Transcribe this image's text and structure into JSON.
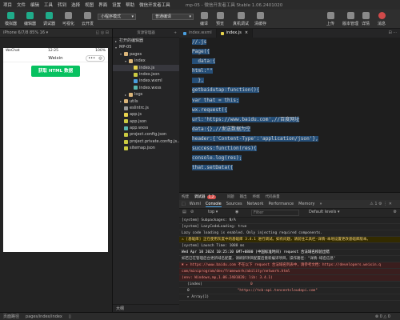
{
  "menubar": {
    "items": [
      "项目",
      "文件",
      "编辑",
      "工具",
      "转到",
      "选择",
      "视图",
      "界面",
      "设置",
      "帮助",
      "微信开发者工具"
    ],
    "title": "mp-05 - 微信开发者工具 Stable 1.06.2401020"
  },
  "toolbar": {
    "left_buttons": [
      "模拟器",
      "编辑器",
      "调试器",
      "可视化",
      "云开发"
    ],
    "mode_select": "小程序模式",
    "compile_select": "普通编译",
    "mid_buttons": [
      "编译",
      "预览",
      "真机调试",
      "清缓存"
    ],
    "right_buttons": [
      "上传",
      "版本管理",
      "详情",
      "消息"
    ]
  },
  "simulator": {
    "device_label": "iPhone 6/7/8 85% 16 ▾",
    "tools": "◱ ◎ ⊟",
    "status_left": "WeChat",
    "status_time": "12:25",
    "status_right": "100%",
    "nav_title": "Weixin",
    "capsule_dots": "•••",
    "capsule_circle": "◎",
    "button_label": "获取 HTML 数据"
  },
  "explorer": {
    "header": "资源管理器",
    "plus": "+",
    "items": [
      {
        "label": "打开的编辑器",
        "indent": 0,
        "type": "arrow",
        "arrow": "▸"
      },
      {
        "label": "MP-05",
        "indent": 0,
        "type": "arrow",
        "arrow": "▾"
      },
      {
        "label": "pages",
        "indent": 1,
        "type": "folder",
        "arrow": "▾"
      },
      {
        "label": "index",
        "indent": 2,
        "type": "folder",
        "arrow": "▾"
      },
      {
        "label": "index.js",
        "indent": 3,
        "type": "js",
        "selected": true
      },
      {
        "label": "index.json",
        "indent": 3,
        "type": "json"
      },
      {
        "label": "index.wxml",
        "indent": 3,
        "type": "wxml"
      },
      {
        "label": "index.wxss",
        "indent": 3,
        "type": "wxss"
      },
      {
        "label": "logs",
        "indent": 2,
        "type": "folder",
        "arrow": "▸"
      },
      {
        "label": "utils",
        "indent": 1,
        "type": "folder",
        "arrow": "▸"
      },
      {
        "label": "eslintrc.js",
        "indent": 1,
        "type": "file"
      },
      {
        "label": "app.js",
        "indent": 1,
        "type": "js"
      },
      {
        "label": "app.json",
        "indent": 1,
        "type": "json"
      },
      {
        "label": "app.wxss",
        "indent": 1,
        "type": "wxss"
      },
      {
        "label": "project.config.json",
        "indent": 1,
        "type": "json"
      },
      {
        "label": "project.private.config.js...",
        "indent": 1,
        "type": "json"
      },
      {
        "label": "sitemap.json",
        "indent": 1,
        "type": "json"
      }
    ],
    "outline": "大纲"
  },
  "editor": {
    "tabs": [
      {
        "label": "index.wxml",
        "active": false
      },
      {
        "label": "index.js",
        "active": true
      }
    ],
    "tools": "⊟ ···",
    "lines": [
      "//.js",
      "Page({",
      "  data:{",
      "html:\"\"",
      "  },",
      "getbaidutap:function(){",
      "var that = this;",
      "wx.request({",
      "url:'https://www.baidu.com',//百度网址",
      "data:{},//发送数据为空",
      "header:{'Content-Type':'application/json'},",
      "success:function(res){",
      "console.log(res);",
      "that.setData({"
    ]
  },
  "devtools": {
    "top_tabs": [
      "构建",
      "调试器",
      "问题",
      "输出",
      "终端",
      "代码质量"
    ],
    "badge": "1,2",
    "tabs": [
      "Wxml",
      "Console",
      "Sources",
      "Network",
      "Performance",
      "Memory"
    ],
    "more": "»",
    "right_icons": "⚠ 1  ⚙  ⋮  ✕",
    "context": "top",
    "filter_placeholder": "Filter",
    "levels": "Default levels ▾",
    "console_lines": [
      {
        "text": "[system] Subpackages: N/A",
        "kind": "normal",
        "src": ""
      },
      {
        "text": "[system] LazyCodeLoading: true",
        "kind": "normal",
        "src": ""
      },
      {
        "text": "Lazy code loading is enabled. Only injecting required components.",
        "kind": "normal",
        "src": ""
      },
      {
        "text": "⚠ [基础库] 正在使用灰度中的基础库 3.4.1 进行调试。如有问题，请前往工具栏-详情-本地设置更改基础库版本。",
        "kind": "warn",
        "src": ""
      },
      {
        "text": "[system] Launch Time: 1088 ms",
        "kind": "normal",
        "src": ""
      },
      {
        "text": "Wed Apr 10 2024 10:25:10 GMT+0800 (中国标准时间) request 合法域名校验出错",
        "kind": "bold",
        "src": ""
      },
      {
        "text": "如若已在管理后台更新域名配置，请刷新项目配置后重新编译项目，操作路径：\"详情-域名信息\"",
        "kind": "normal",
        "src": ""
      },
      {
        "text": "✖ ▸ https://www.baidu.com 不在以下 request 合法域名列表中，请参考文档：https://developers.weixin.q",
        "kind": "err",
        "src": ""
      },
      {
        "text": "com/miniprogram/dev/framework/ability/network.html",
        "kind": "err",
        "src": ""
      },
      {
        "text": "(env: Windows,mp,1.06.2401020; lib: 3.4.1)",
        "kind": "err",
        "src": ""
      },
      {
        "text": "(index)",
        "kind": "table",
        "src": "0"
      },
      {
        "text": "0",
        "kind": "table",
        "src": "\"https://tcb-api.tencentcloudapi.com\""
      },
      {
        "text": "▸ Array(1)",
        "kind": "table",
        "src": ""
      }
    ]
  },
  "statusbar": {
    "items": [
      "页面路径",
      "pages/index/index",
      "▯"
    ],
    "right": "⊗ 0 △ 0"
  }
}
